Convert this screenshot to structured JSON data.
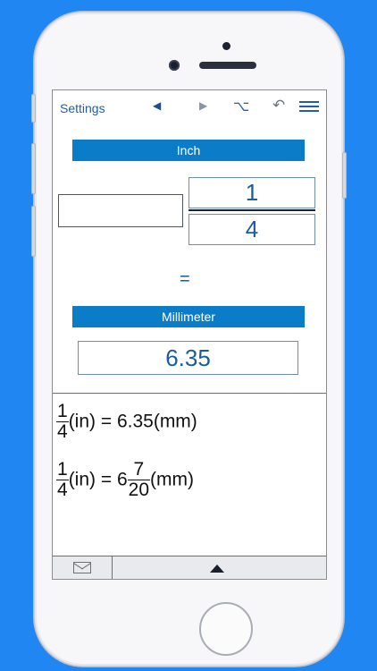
{
  "toolbar": {
    "settings_label": "Settings",
    "icons": [
      "prev-triangle-icon",
      "next-triangle-icon",
      "option-key-icon",
      "undo-icon",
      "menu-icon"
    ]
  },
  "converter": {
    "from_unit": "Inch",
    "input_value": "",
    "fraction": {
      "numerator": "1",
      "denominator": "4"
    },
    "equals": "=",
    "to_unit": "Millimeter",
    "result": "6.35"
  },
  "equations": {
    "eq1": {
      "num": "1",
      "den": "4",
      "from": "(in) = 6.35(mm)"
    },
    "eq2": {
      "num": "1",
      "den": "4",
      "middle": "(in) = 6",
      "mix_num": "7",
      "mix_den": "20",
      "tail": "(mm)"
    }
  },
  "colors": {
    "background": "#1f86f2",
    "unit_bar": "#0b7cc8",
    "text_blue": "#1a5ca3"
  }
}
